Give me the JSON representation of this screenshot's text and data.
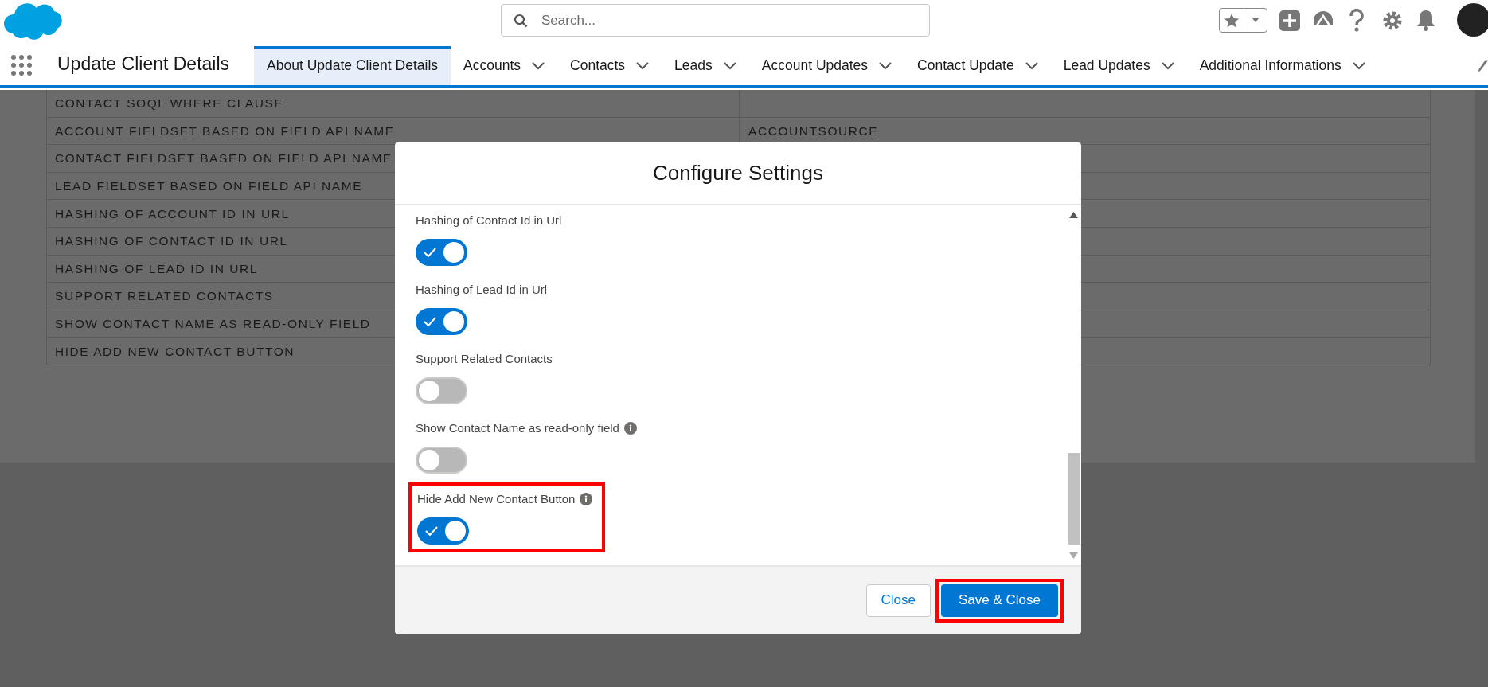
{
  "header": {
    "search": {
      "placeholder": "Search..."
    }
  },
  "nav": {
    "app_name": "Update Client Details",
    "tabs": [
      {
        "label": "About Update Client Details",
        "selected": true,
        "dropdown": false
      },
      {
        "label": "Accounts",
        "selected": false,
        "dropdown": true
      },
      {
        "label": "Contacts",
        "selected": false,
        "dropdown": true
      },
      {
        "label": "Leads",
        "selected": false,
        "dropdown": true
      },
      {
        "label": "Account Updates",
        "selected": false,
        "dropdown": true
      },
      {
        "label": "Contact Update",
        "selected": false,
        "dropdown": true
      },
      {
        "label": "Lead Updates",
        "selected": false,
        "dropdown": true
      },
      {
        "label": "Additional Informations",
        "selected": false,
        "dropdown": true
      }
    ]
  },
  "table": {
    "rows": [
      {
        "label": "CONTACT SOQL WHERE CLAUSE"
      },
      {
        "label": "ACCOUNT FIELDSET BASED ON FIELD API NAME",
        "value": "ACCOUNTSOURCE"
      },
      {
        "label": "CONTACT FIELDSET BASED ON FIELD API NAME"
      },
      {
        "label": "LEAD FIELDSET BASED ON FIELD API NAME"
      },
      {
        "label": "HASHING OF ACCOUNT ID IN URL"
      },
      {
        "label": "HASHING OF CONTACT ID IN URL"
      },
      {
        "label": "HASHING OF LEAD ID IN URL"
      },
      {
        "label": "SUPPORT RELATED CONTACTS"
      },
      {
        "label": "SHOW CONTACT NAME AS READ-ONLY FIELD"
      },
      {
        "label": "HIDE ADD NEW CONTACT BUTTON"
      }
    ]
  },
  "modal": {
    "title": "Configure Settings",
    "settings": [
      {
        "label": "Hashing of Contact Id in Url",
        "on": true,
        "info": false,
        "highlighted": false
      },
      {
        "label": "Hashing of Lead Id in Url",
        "on": true,
        "info": false,
        "highlighted": false
      },
      {
        "label": "Support Related Contacts",
        "on": false,
        "info": false,
        "highlighted": false
      },
      {
        "label": "Show Contact Name as read-only field",
        "on": false,
        "info": true,
        "highlighted": false
      },
      {
        "label": "Hide Add New Contact Button",
        "on": true,
        "info": true,
        "highlighted": true
      }
    ],
    "buttons": [
      {
        "label": "Close",
        "kind": "neutral",
        "highlighted": false
      },
      {
        "label": "Save & Close",
        "kind": "brand",
        "highlighted": true
      }
    ]
  }
}
